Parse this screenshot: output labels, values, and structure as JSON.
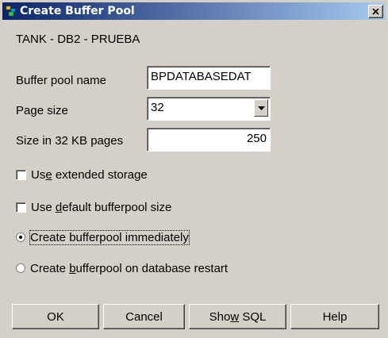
{
  "window": {
    "title": "Create Buffer Pool",
    "close_label": "x"
  },
  "context": {
    "database_path": "TANK - DB2 - PRUEBA"
  },
  "form": {
    "buffer_pool_name_label": "Buffer pool name",
    "buffer_pool_name_value": "BPDATABASEDAT",
    "page_size_label": "Page size",
    "page_size_value": "32",
    "size_pages_label": "Size in 32 KB pages",
    "size_pages_value": "250"
  },
  "options": {
    "extended_storage": {
      "pre": "Us",
      "accel": "e",
      "post": " extended storage",
      "checked": false
    },
    "default_size": {
      "pre": "Use ",
      "accel": "d",
      "post": "efault bufferpool size",
      "checked": false
    },
    "create_immediately": {
      "label": "Create bufferpool immediately",
      "selected": true
    },
    "create_on_restart": {
      "pre": "Create ",
      "accel": "b",
      "post": "ufferpool on database restart",
      "selected": false
    }
  },
  "buttons": {
    "ok": "OK",
    "cancel": "Cancel",
    "show_sql_pre": "Sho",
    "show_sql_accel": "w",
    "show_sql_post": " SQL",
    "help": "Help"
  },
  "colors": {
    "titlebar_start": "#0a246a",
    "titlebar_end": "#a6caf0",
    "dialog_bg": "#d4d0c8"
  },
  "icons": {
    "title": "db2-buffer-pool-icon",
    "close": "close-icon",
    "combo": "chevron-down-icon"
  }
}
